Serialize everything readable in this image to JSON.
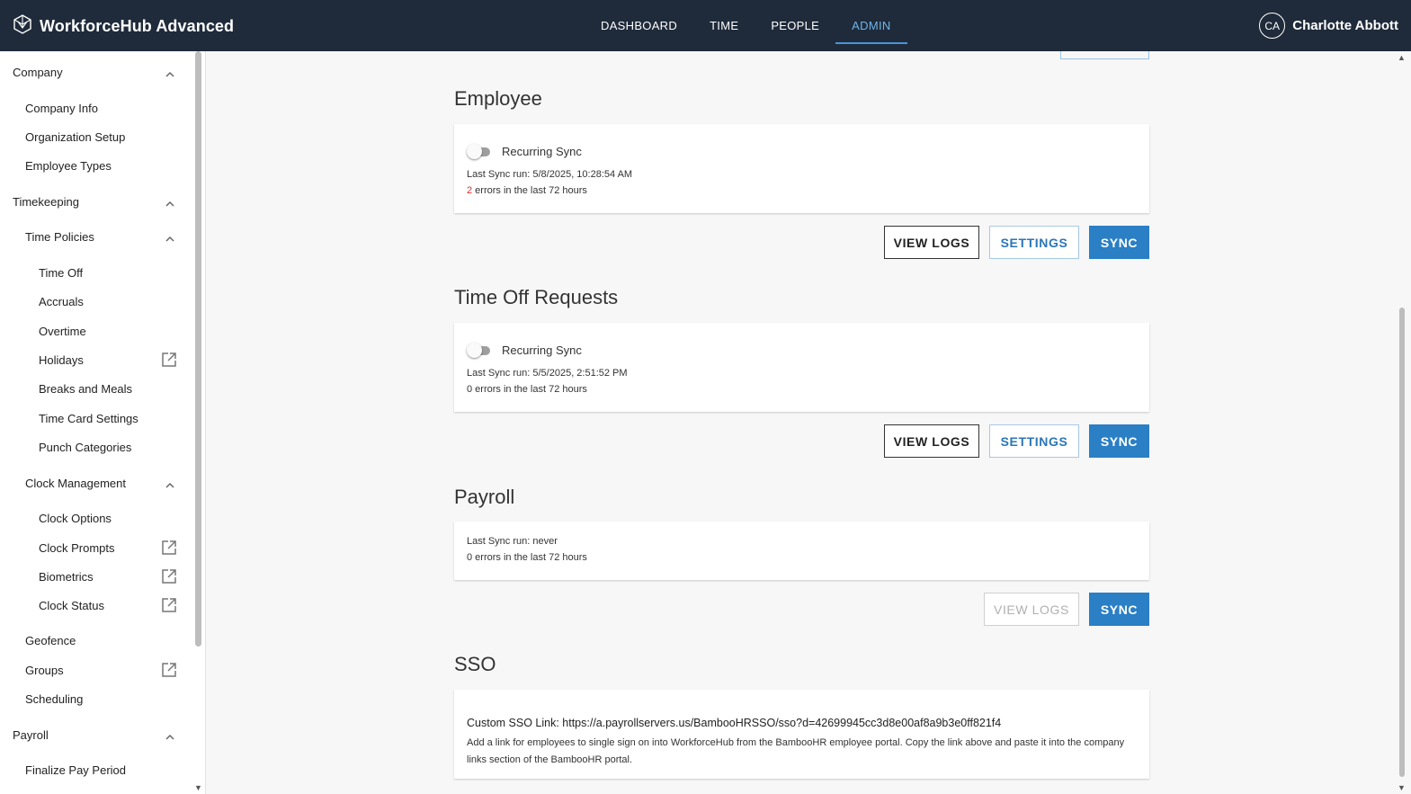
{
  "app": {
    "title": "WorkforceHub Advanced"
  },
  "nav": {
    "items": [
      "DASHBOARD",
      "TIME",
      "PEOPLE",
      "ADMIN"
    ],
    "active": "ADMIN"
  },
  "user": {
    "initials": "CA",
    "name": "Charlotte Abbott"
  },
  "sidebar": {
    "items": [
      {
        "label": "Company",
        "level": 0,
        "chevron": true
      },
      {
        "label": "Company Info",
        "level": 1
      },
      {
        "label": "Organization Setup",
        "level": 1
      },
      {
        "label": "Employee Types",
        "level": 1
      },
      {
        "label": "Timekeeping",
        "level": 0,
        "chevron": true
      },
      {
        "label": "Time Policies",
        "level": 1,
        "chevron": true
      },
      {
        "label": "Time Off",
        "level": 2
      },
      {
        "label": "Accruals",
        "level": 2
      },
      {
        "label": "Overtime",
        "level": 2
      },
      {
        "label": "Holidays",
        "level": 2,
        "external": true
      },
      {
        "label": "Breaks and Meals",
        "level": 2
      },
      {
        "label": "Time Card Settings",
        "level": 2
      },
      {
        "label": "Punch Categories",
        "level": 2
      },
      {
        "label": "Clock Management",
        "level": 1,
        "chevron": true
      },
      {
        "label": "Clock Options",
        "level": 2
      },
      {
        "label": "Clock Prompts",
        "level": 2,
        "external": true
      },
      {
        "label": "Biometrics",
        "level": 2,
        "external": true
      },
      {
        "label": "Clock Status",
        "level": 2,
        "external": true
      },
      {
        "label": "Geofence",
        "level": 1
      },
      {
        "label": "Groups",
        "level": 1,
        "external": true
      },
      {
        "label": "Scheduling",
        "level": 1
      },
      {
        "label": "Payroll",
        "level": 0,
        "chevron": true
      },
      {
        "label": "Finalize Pay Period",
        "level": 1
      }
    ]
  },
  "sections": {
    "employee": {
      "title": "Employee",
      "toggle_label": "Recurring Sync",
      "last_sync": "Last Sync run: 5/8/2025, 10:28:54 AM",
      "error_count": "2",
      "error_suffix": " errors in the last 72 hours"
    },
    "time_off": {
      "title": "Time Off Requests",
      "toggle_label": "Recurring Sync",
      "last_sync": "Last Sync run: 5/5/2025, 2:51:52 PM",
      "errors": "0 errors in the last 72 hours"
    },
    "payroll": {
      "title": "Payroll",
      "last_sync": "Last Sync run: never",
      "errors": "0 errors in the last 72 hours"
    },
    "sso": {
      "title": "SSO",
      "link": "Custom SSO Link: https://a.payrollservers.us/BambooHRSSO/sso?d=42699945cc3d8e00af8a9b3e0ff821f4",
      "description": "Add a link for employees to single sign on into WorkforceHub from the BambooHR employee portal. Copy the link above and paste it into the company links section of the BambooHR portal."
    }
  },
  "buttons": {
    "view_logs": "VIEW LOGS",
    "settings": "SETTINGS",
    "sync": "SYNC"
  },
  "colors": {
    "topbar": "#1f2b3a",
    "accent": "#2a7fc5",
    "active_nav": "#6fb3e8",
    "error": "#d32f2f"
  }
}
